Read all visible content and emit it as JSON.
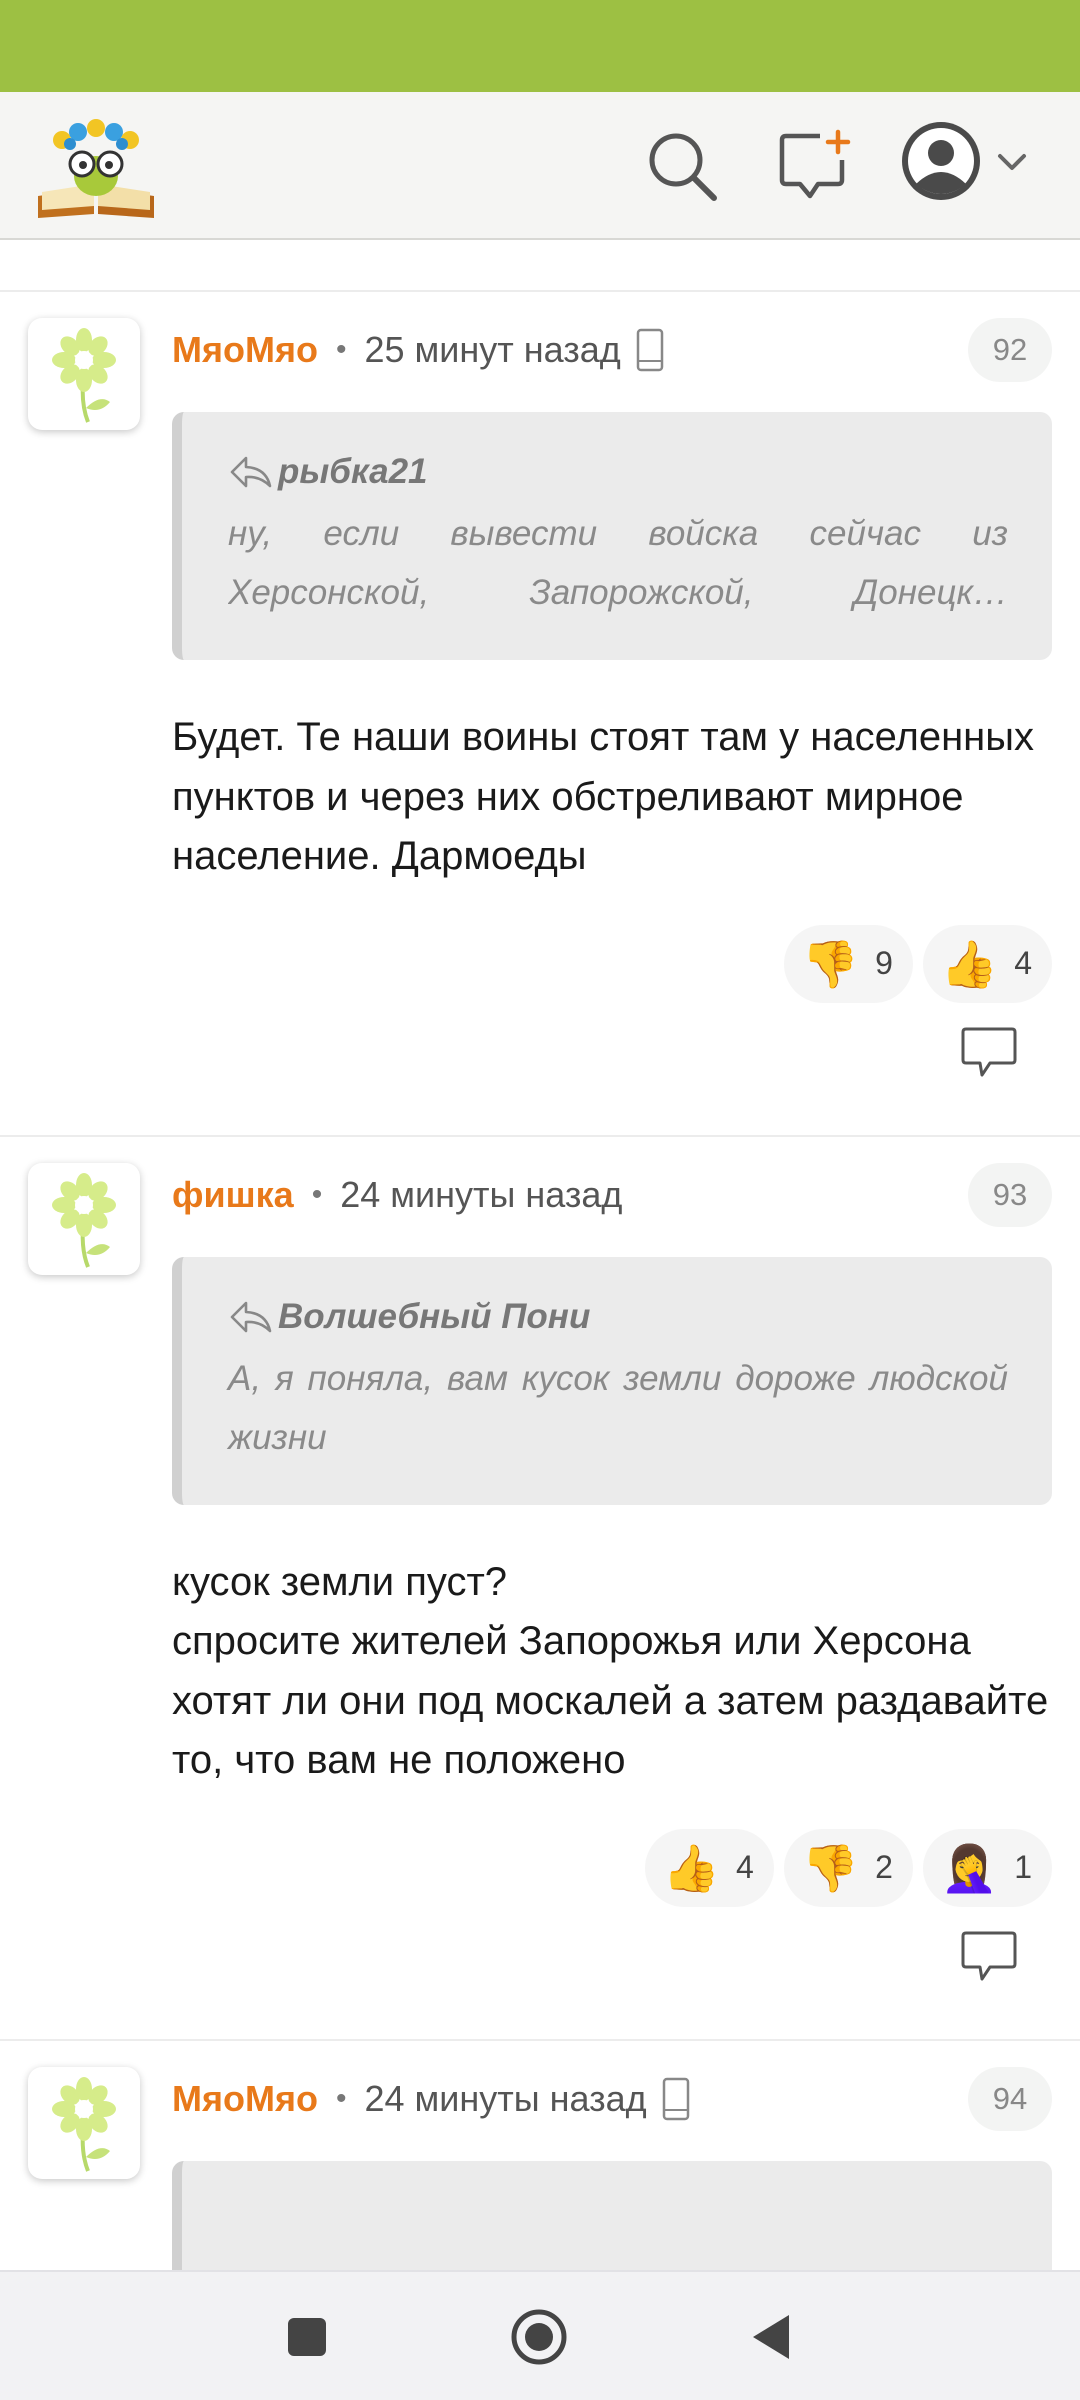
{
  "header": {
    "logo_name": "book-character-logo",
    "icons": [
      "search-icon",
      "new-message-icon",
      "user-avatar-icon",
      "chevron-down-icon"
    ]
  },
  "colors": {
    "status_bar": "#9dc043",
    "author": "#e8791a",
    "quote_bg": "#ebebeb",
    "header_bg": "#f5f5f3"
  },
  "comments": [
    {
      "author": "МяоМяо",
      "time": "25 минут назад",
      "number": "92",
      "quote_author": "рыбка21",
      "quote_text": "ну, если вывести войска сейчас из Херсонской, Запорожской, Донецк…",
      "text": "Будет. Те наши воины стоят там у населенных пунктов и через них обстреливают мирное население. Дармоеды",
      "reactions": [
        {
          "emoji": "👎",
          "count": "9"
        },
        {
          "emoji": "👍",
          "count": "4"
        }
      ]
    },
    {
      "author": "фишка",
      "time": "24 минуты назад",
      "number": "93",
      "quote_author": "Волшебный Пони",
      "quote_text": "А, я поняла, вам кусок земли дороже людской жизни",
      "text": "кусок земли пуст?\nспросите жителей Запорожья или Херсона хотят ли они под москалей а затем раздавайте то, что вам не положено",
      "reactions": [
        {
          "emoji": "👍",
          "count": "4"
        },
        {
          "emoji": "👎",
          "count": "2"
        },
        {
          "emoji": "🤦‍♀️",
          "count": "1"
        }
      ]
    },
    {
      "author": "МяоМяо",
      "time": "24 минуты назад",
      "number": "94"
    }
  ]
}
